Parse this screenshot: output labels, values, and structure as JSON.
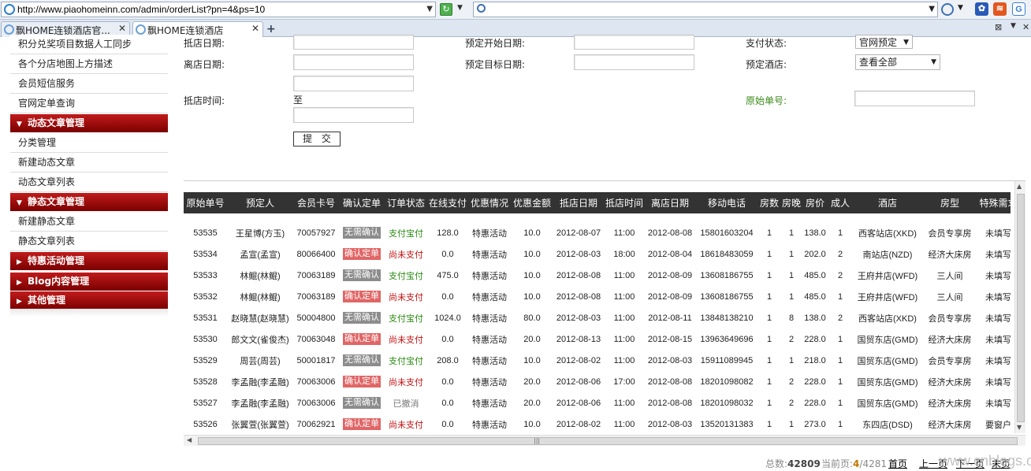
{
  "browser": {
    "url": "http://www.piaohomeinn.com/admin/orderList?pn=4&ps=10",
    "tabs": [
      {
        "title": "飘HOME连锁酒店官...",
        "active": false
      },
      {
        "title": "飘HOME连锁酒店",
        "active": true
      }
    ]
  },
  "sidebar": {
    "items": [
      {
        "type": "item",
        "label": "积分兑奖项目数据人工同步"
      },
      {
        "type": "item",
        "label": "各个分店地图上方描述"
      },
      {
        "type": "item",
        "label": "会员短信服务"
      },
      {
        "type": "item",
        "label": "官网定单查询"
      },
      {
        "type": "header",
        "label": "动态文章管理",
        "expanded": true
      },
      {
        "type": "item",
        "label": "分类管理"
      },
      {
        "type": "item",
        "label": "新建动态文章"
      },
      {
        "type": "item",
        "label": "动态文章列表"
      },
      {
        "type": "header",
        "label": "静态文章管理",
        "expanded": true
      },
      {
        "type": "item",
        "label": "新建静态文章"
      },
      {
        "type": "item",
        "label": "静态文章列表"
      },
      {
        "type": "header",
        "label": "特惠活动管理",
        "expanded": false
      },
      {
        "type": "header",
        "label": "Blog内容管理",
        "expanded": false
      },
      {
        "type": "header",
        "label": "其他管理",
        "expanded": false
      }
    ]
  },
  "form": {
    "checkin_date_label": "抵店日期:",
    "checkout_date_label": "离店日期:",
    "checkin_time_label": "抵店时间:",
    "time_to": "至",
    "book_start_label": "预定开始日期:",
    "book_target_label": "预定目标日期:",
    "pay_status_label": "支付状态:",
    "pay_status_value": "官网预定",
    "hotel_label": "预定酒店:",
    "hotel_value": "查看全部",
    "order_no_label": "原始单号:",
    "submit_label": "提 交"
  },
  "table": {
    "columns": [
      "原始单号",
      "预定人",
      "会员卡号",
      "确认定单",
      "订单状态",
      "在线支付",
      "优惠情况",
      "优惠金额",
      "抵店日期",
      "抵店时间",
      "离店日期",
      "移动电话",
      "房数",
      "房晚",
      "房价",
      "成人",
      "酒店",
      "房型",
      "特殊需求"
    ],
    "rows": [
      [
        "53535",
        "王星博(方玉)",
        "70057927",
        "无需确认",
        "支付宝付",
        "128.0",
        "特惠活动",
        "10.0",
        "2012-08-07",
        "11:00",
        "2012-08-08",
        "15801603204",
        "1",
        "1",
        "138.0",
        "1",
        "西客站店(XKD)",
        "会员专享房",
        "未填写"
      ],
      [
        "53534",
        "孟宣(孟宣)",
        "80066400",
        "确认定单",
        "尚未支付",
        "0.0",
        "特惠活动",
        "10.0",
        "2012-08-03",
        "18:00",
        "2012-08-04",
        "18618483059",
        "1",
        "1",
        "202.0",
        "2",
        "南站店(NZD)",
        "经济大床房",
        "未填写"
      ],
      [
        "53533",
        "林鲲(林鲲)",
        "70063189",
        "无需确认",
        "支付宝付",
        "475.0",
        "特惠活动",
        "10.0",
        "2012-08-08",
        "11:00",
        "2012-08-09",
        "13608186755",
        "1",
        "1",
        "485.0",
        "2",
        "王府井店(WFD)",
        "三人间",
        "未填写"
      ],
      [
        "53532",
        "林鲲(林鲲)",
        "70063189",
        "确认定单",
        "尚未支付",
        "0.0",
        "特惠活动",
        "10.0",
        "2012-08-08",
        "11:00",
        "2012-08-09",
        "13608186755",
        "1",
        "1",
        "485.0",
        "1",
        "王府井店(WFD)",
        "三人间",
        "未填写"
      ],
      [
        "53531",
        "赵晓慧(赵晓慧)",
        "50004800",
        "无需确认",
        "支付宝付",
        "1024.0",
        "特惠活动",
        "80.0",
        "2012-08-03",
        "11:00",
        "2012-08-11",
        "13848138210",
        "1",
        "8",
        "138.0",
        "2",
        "西客站店(XKD)",
        "会员专享房",
        "未填写"
      ],
      [
        "53530",
        "郎文文(雀俊杰)",
        "70063048",
        "确认定单",
        "尚未支付",
        "0.0",
        "特惠活动",
        "20.0",
        "2012-08-13",
        "11:00",
        "2012-08-15",
        "13963649696",
        "1",
        "2",
        "228.0",
        "1",
        "国贸东店(GMD)",
        "经济大床房",
        "未填写"
      ],
      [
        "53529",
        "周芸(周芸)",
        "50001817",
        "无需确认",
        "支付宝付",
        "208.0",
        "特惠活动",
        "10.0",
        "2012-08-02",
        "11:00",
        "2012-08-03",
        "15911089945",
        "1",
        "1",
        "218.0",
        "1",
        "国贸东店(GMD)",
        "会员专享房",
        "未填写"
      ],
      [
        "53528",
        "李孟融(李孟融)",
        "70063006",
        "确认定单",
        "尚未支付",
        "0.0",
        "特惠活动",
        "20.0",
        "2012-08-06",
        "17:00",
        "2012-08-08",
        "18201098082",
        "1",
        "2",
        "228.0",
        "1",
        "国贸东店(GMD)",
        "经济大床房",
        "未填写"
      ],
      [
        "53527",
        "李孟融(李孟融)",
        "70063006",
        "无需确认",
        "已撤消",
        "0.0",
        "特惠活动",
        "20.0",
        "2012-08-06",
        "11:00",
        "2012-08-08",
        "18201098032",
        "1",
        "2",
        "228.0",
        "1",
        "国贸东店(GMD)",
        "经济大床房",
        "未填写"
      ],
      [
        "53526",
        "张翼萱(张翼萱)",
        "70062921",
        "确认定单",
        "尚未支付",
        "0.0",
        "特惠活动",
        "10.0",
        "2012-08-02",
        "11:00",
        "2012-08-03",
        "13520131383",
        "1",
        "1",
        "273.0",
        "1",
        "东四店(DSD)",
        "经济大床房",
        "要窗户"
      ]
    ]
  },
  "pager": {
    "total_label": "总数:",
    "total": "42809",
    "current_label": "当前页:",
    "current": "4",
    "pages": "/4281",
    "first": "首页",
    "prev": "上一页",
    "next": "下一页",
    "last": "末页"
  },
  "watermark": "www.cnblogs.org",
  "colors": {
    "header_red": "#a30c0c",
    "table_head": "#333333",
    "badge_gray": "#8c8c8c",
    "badge_red": "#e06666",
    "paid_green": "#2a8a12",
    "unpaid_red": "#c41010"
  }
}
